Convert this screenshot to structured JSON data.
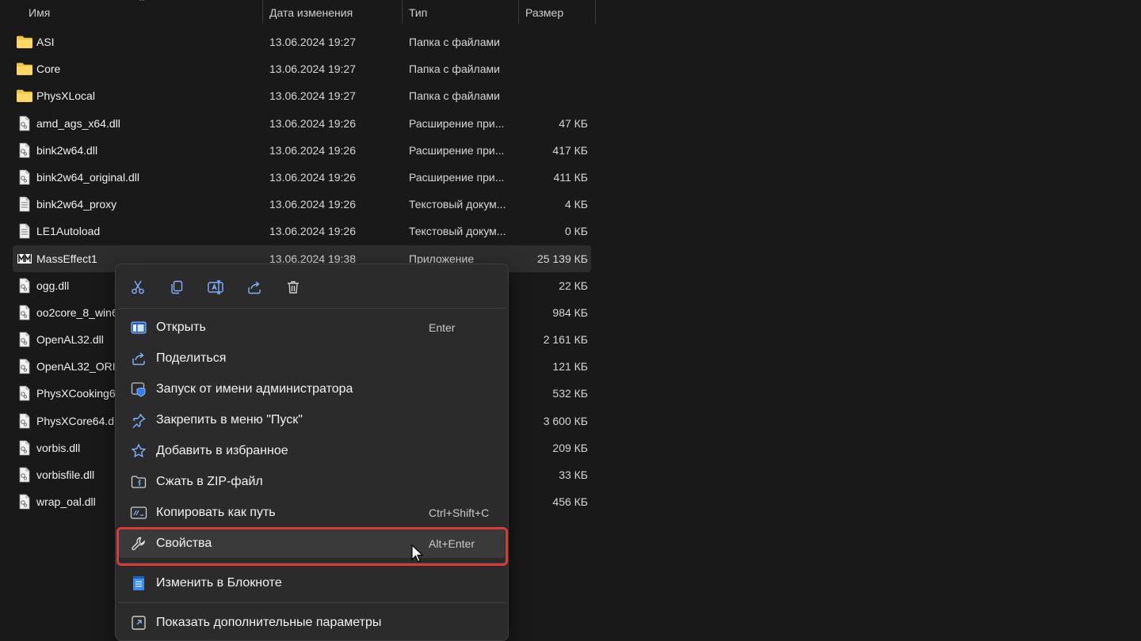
{
  "columns": {
    "name": "Имя",
    "date": "Дата изменения",
    "type": "Тип",
    "size": "Размер"
  },
  "files": [
    {
      "name": "ASI",
      "date": "13.06.2024 19:27",
      "type": "Папка с файлами",
      "size": "",
      "icon": "folder-icon"
    },
    {
      "name": "Core",
      "date": "13.06.2024 19:27",
      "type": "Папка с файлами",
      "size": "",
      "icon": "folder-icon"
    },
    {
      "name": "PhysXLocal",
      "date": "13.06.2024 19:27",
      "type": "Папка с файлами",
      "size": "",
      "icon": "folder-icon"
    },
    {
      "name": "amd_ags_x64.dll",
      "date": "13.06.2024 19:26",
      "type": "Расширение при...",
      "size": "47 КБ",
      "icon": "dll-file-icon"
    },
    {
      "name": "bink2w64.dll",
      "date": "13.06.2024 19:26",
      "type": "Расширение при...",
      "size": "417 КБ",
      "icon": "dll-file-icon"
    },
    {
      "name": "bink2w64_original.dll",
      "date": "13.06.2024 19:26",
      "type": "Расширение при...",
      "size": "411 КБ",
      "icon": "dll-file-icon"
    },
    {
      "name": "bink2w64_proxy",
      "date": "13.06.2024 19:26",
      "type": "Текстовый докум...",
      "size": "4 КБ",
      "icon": "text-file-icon"
    },
    {
      "name": "LE1Autoload",
      "date": "13.06.2024 19:26",
      "type": "Текстовый докум...",
      "size": "0 КБ",
      "icon": "text-file-icon"
    },
    {
      "name": "MassEffect1",
      "date": "13.06.2024 19:38",
      "type": "Приложение",
      "size": "25 139 КБ",
      "icon": "app-icon"
    },
    {
      "name": "ogg.dll",
      "date": "",
      "type": "",
      "size": "22 КБ",
      "icon": "dll-file-icon"
    },
    {
      "name": "oo2core_8_win6",
      "date": "",
      "type": "",
      "size": "984 КБ",
      "icon": "dll-file-icon"
    },
    {
      "name": "OpenAL32.dll",
      "date": "",
      "type": "",
      "size": "2 161 КБ",
      "icon": "dll-file-icon"
    },
    {
      "name": "OpenAL32_ORI",
      "date": "",
      "type": "",
      "size": "121 КБ",
      "icon": "dll-file-icon"
    },
    {
      "name": "PhysXCooking6",
      "date": "",
      "type": "",
      "size": "532 КБ",
      "icon": "dll-file-icon"
    },
    {
      "name": "PhysXCore64.d",
      "date": "",
      "type": "",
      "size": "3 600 КБ",
      "icon": "dll-file-icon"
    },
    {
      "name": "vorbis.dll",
      "date": "",
      "type": "",
      "size": "209 КБ",
      "icon": "dll-file-icon"
    },
    {
      "name": "vorbisfile.dll",
      "date": "",
      "type": "",
      "size": "33 КБ",
      "icon": "dll-file-icon"
    },
    {
      "name": "wrap_oal.dll",
      "date": "",
      "type": "",
      "size": "456 КБ",
      "icon": "dll-file-icon"
    }
  ],
  "context_menu": {
    "toolbar": [
      "cut-icon",
      "copy-icon",
      "rename-icon",
      "share-icon",
      "delete-icon"
    ],
    "items": [
      {
        "label": "Открыть",
        "shortcut": "Enter",
        "icon": "open-icon"
      },
      {
        "label": "Поделиться",
        "shortcut": "",
        "icon": "share-icon"
      },
      {
        "label": "Запуск от имени администратора",
        "shortcut": "",
        "icon": "shield-icon"
      },
      {
        "label": "Закрепить в меню \"Пуск\"",
        "shortcut": "",
        "icon": "pin-icon"
      },
      {
        "label": "Добавить в избранное",
        "shortcut": "",
        "icon": "star-icon"
      },
      {
        "label": "Сжать в ZIP-файл",
        "shortcut": "",
        "icon": "zip-folder-icon"
      },
      {
        "label": "Копировать как путь",
        "shortcut": "Ctrl+Shift+C",
        "icon": "copy-path-icon"
      },
      {
        "label": "Свойства",
        "shortcut": "Alt+Enter",
        "icon": "wrench-icon"
      },
      {
        "label": "Изменить в Блокноте",
        "shortcut": "",
        "icon": "notepad-icon"
      },
      {
        "label": "Показать дополнительные параметры",
        "shortcut": "",
        "icon": "more-options-icon"
      }
    ]
  },
  "colors": {
    "background": "#191919",
    "menu_bg": "#2b2b2b",
    "highlight": "#d93a3a",
    "folder": "#f4c542",
    "accent": "#60a5fa"
  }
}
